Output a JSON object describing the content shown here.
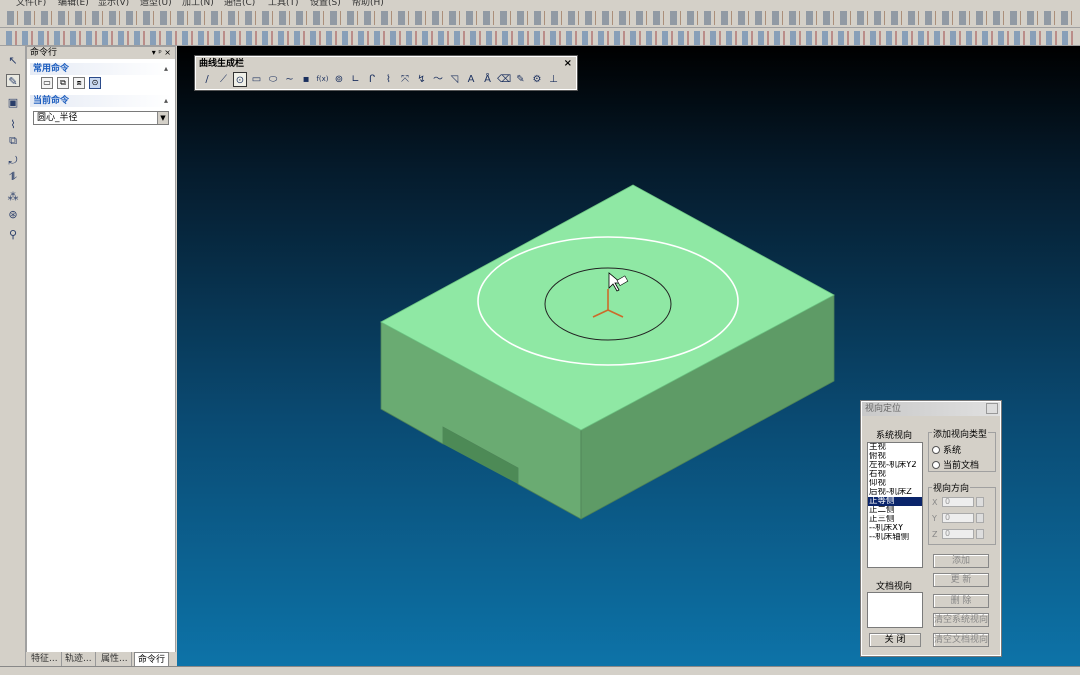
{
  "menubar": {
    "items": [
      "文件(F)",
      "编辑(E)",
      "显示(V)",
      "造型(U)",
      "加工(N)",
      "通信(C)",
      "工具(T)",
      "设置(S)",
      "帮助(H)"
    ]
  },
  "left_panel": {
    "title": "命令行",
    "title_controls": "▾ ᵖ ×",
    "section_common": "常用命令",
    "section_current": "当前命令",
    "current_command_value": "圆心_半径",
    "bottom_tabs": [
      "特征...",
      "轨迹...",
      "属性...",
      "命令行"
    ]
  },
  "curve_toolbar": {
    "title": "曲线生成栏",
    "close": "×",
    "tools": [
      {
        "name": "line-tool-icon",
        "glyph": "/"
      },
      {
        "name": "polyline-tool-icon",
        "glyph": "⟋"
      },
      {
        "name": "circle-tool-icon",
        "glyph": "⊙"
      },
      {
        "name": "rectangle-tool-icon",
        "glyph": "▭"
      },
      {
        "name": "ellipse-tool-icon",
        "glyph": "⬭"
      },
      {
        "name": "spline-tool-icon",
        "glyph": "∼"
      },
      {
        "name": "point-tool-icon",
        "glyph": "▪"
      },
      {
        "name": "formula-curve-icon",
        "glyph": "f(x)"
      },
      {
        "name": "polygon-tool-icon",
        "glyph": "⊚"
      },
      {
        "name": "ortho-tool-icon",
        "glyph": "∟"
      },
      {
        "name": "fillet-tool-icon",
        "glyph": "ᒋ"
      },
      {
        "name": "offset-tool-icon",
        "glyph": "⌇"
      },
      {
        "name": "trim-tool-icon",
        "glyph": "⤧"
      },
      {
        "name": "extend-tool-icon",
        "glyph": "↯"
      },
      {
        "name": "wave-tool-icon",
        "glyph": "〜"
      },
      {
        "name": "chamfer-tool-icon",
        "glyph": "◹"
      },
      {
        "name": "text-tool-icon",
        "glyph": "A"
      },
      {
        "name": "text-style-icon",
        "glyph": "Å"
      },
      {
        "name": "erase-tool-icon",
        "glyph": "⌫"
      },
      {
        "name": "edit-tool-icon",
        "glyph": "✎"
      },
      {
        "name": "gear-curve-icon",
        "glyph": "⚙"
      },
      {
        "name": "section-tool-icon",
        "glyph": "⊥"
      }
    ]
  },
  "dialog": {
    "title": "视向定位",
    "system_views_label": "系统视向",
    "system_views": [
      "主视",
      "俯视",
      "左视-机床Y2",
      "右视",
      "仰视",
      "后视-机床Z",
      "正等侧",
      "正二侧",
      "正三侧",
      "--机床XY",
      "--机床轴侧"
    ],
    "selected_view": "正等侧",
    "doc_views_label": "文档视向",
    "add_type_label": "添加视向类型",
    "radio_system": "系统",
    "radio_current_doc": "当前文档",
    "direction_label": "视向方向",
    "coords": [
      {
        "axis": "X",
        "value": "0"
      },
      {
        "axis": "Y",
        "value": "0"
      },
      {
        "axis": "Z",
        "value": "0"
      }
    ],
    "btn_add": "添加",
    "btn_modify": "更 新",
    "btn_delete": "删 除",
    "btn_clear_system": "清空系统视向",
    "btn_clear_doc": "清空文档视向",
    "btn_close": "关 闭"
  },
  "colors": {
    "part_top": "#8fe8a4",
    "part_left": "#6aab72",
    "part_right": "#5e9b66",
    "selected": "#0a246a",
    "section_text": "#1f5fbf"
  }
}
